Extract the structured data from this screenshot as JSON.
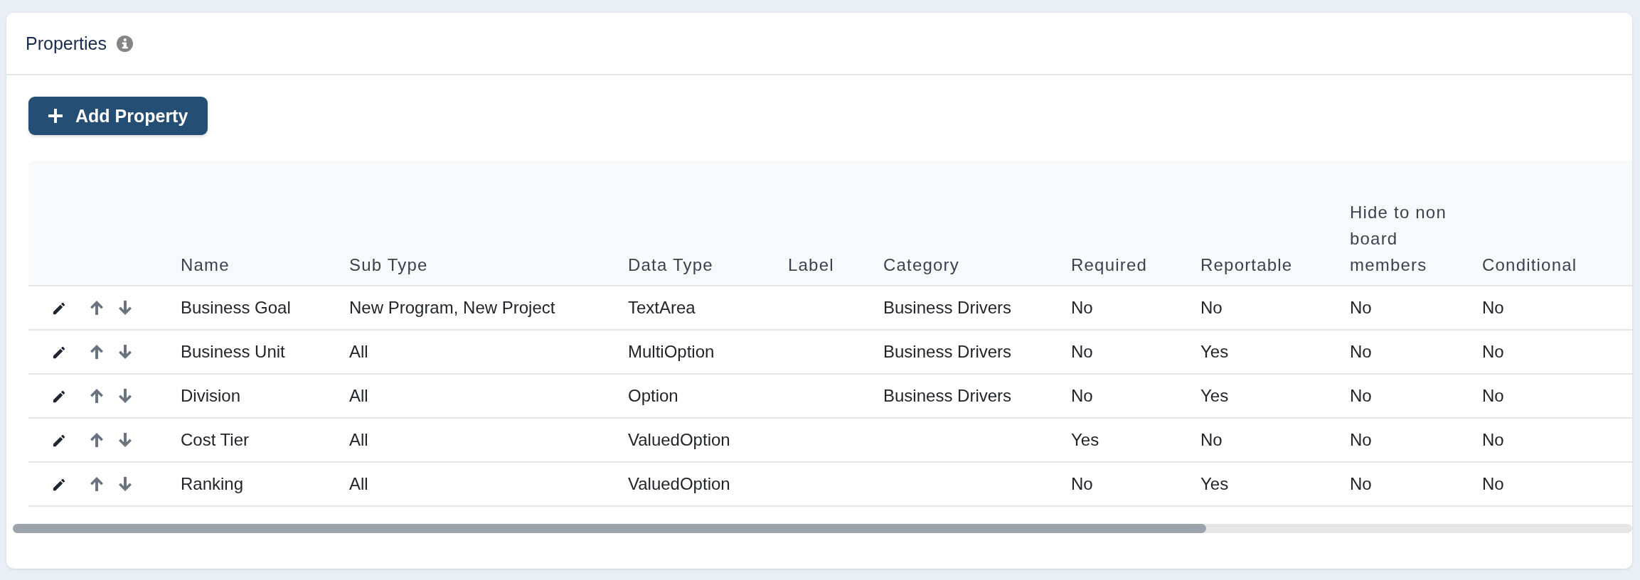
{
  "panel": {
    "title": "Properties"
  },
  "add_button": {
    "label": "Add Property"
  },
  "table": {
    "columns": [
      "Name",
      "Sub Type",
      "Data Type",
      "Label",
      "Category",
      "Required",
      "Reportable",
      "Hide to non board members",
      "Conditional"
    ],
    "rows": [
      {
        "name": "Business Goal",
        "sub_type": "New Program, New Project",
        "data_type": "TextArea",
        "category": "Business Drivers",
        "required": "No",
        "reportable": "No",
        "hide_to_non_board_members": "No",
        "conditional": "No"
      },
      {
        "name": "Business Unit",
        "sub_type": "All",
        "data_type": "MultiOption",
        "category": "Business Drivers",
        "required": "No",
        "reportable": "Yes",
        "hide_to_non_board_members": "No",
        "conditional": "No"
      },
      {
        "name": "Division",
        "sub_type": "All",
        "data_type": "Option",
        "category": "Business Drivers",
        "required": "No",
        "reportable": "Yes",
        "hide_to_non_board_members": "No",
        "conditional": "No"
      },
      {
        "name": "Cost Tier",
        "sub_type": "All",
        "data_type": "ValuedOption",
        "required": "Yes",
        "reportable": "No",
        "hide_to_non_board_members": "No",
        "conditional": "No"
      },
      {
        "name": "Ranking",
        "sub_type": "All",
        "data_type": "ValuedOption",
        "required": "No",
        "reportable": "Yes",
        "hide_to_non_board_members": "No",
        "conditional": "No"
      }
    ]
  }
}
